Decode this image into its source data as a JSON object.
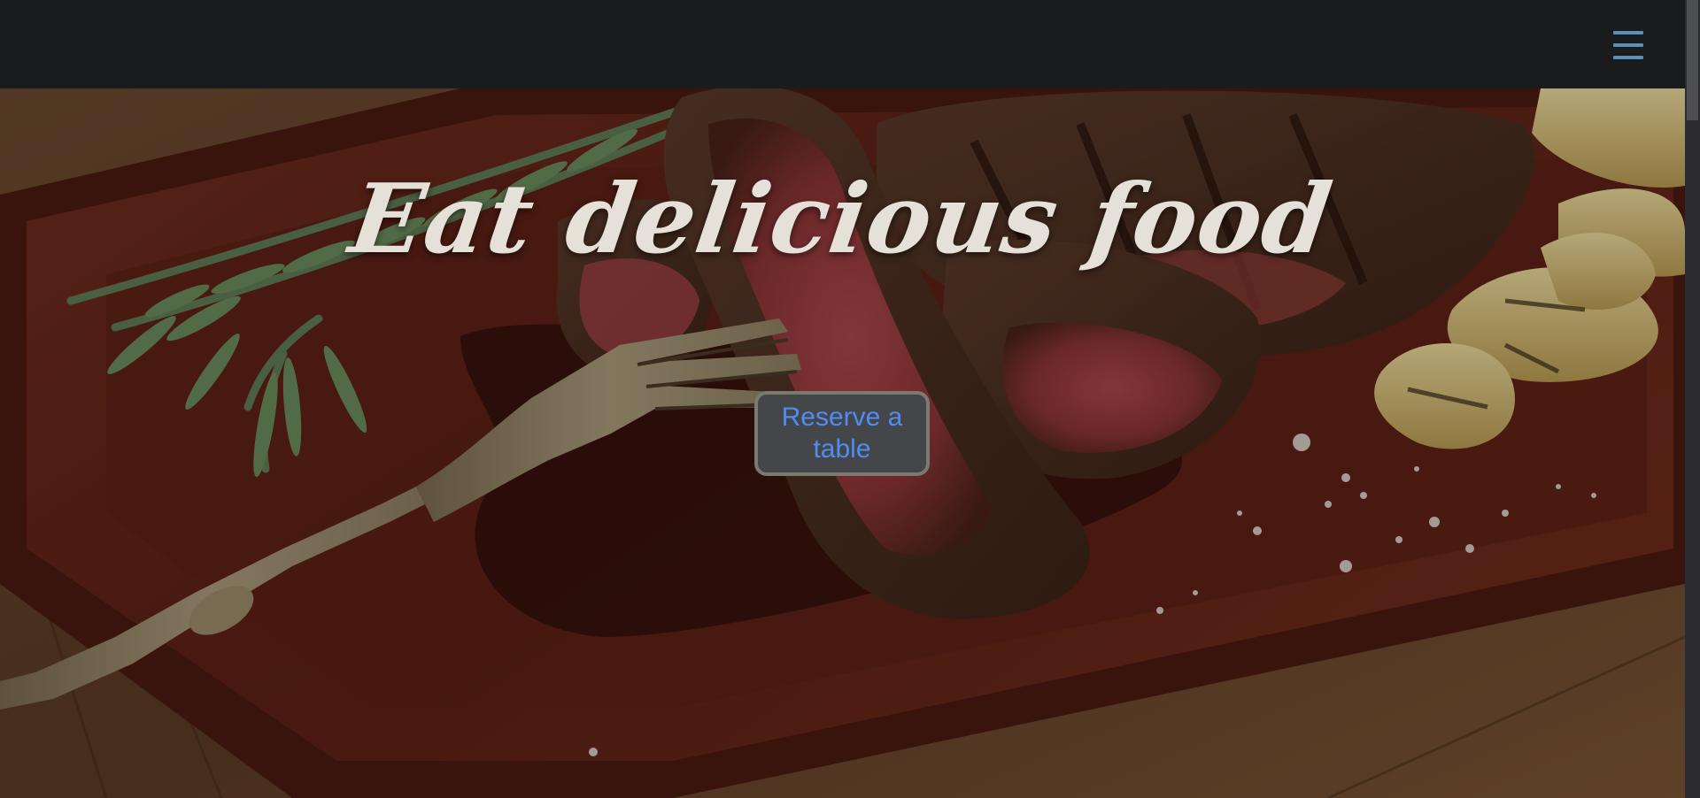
{
  "navbar": {
    "menu_icon": "hamburger-menu-icon",
    "menu_color": "#5c8fb6"
  },
  "hero": {
    "image": "steak-on-cutting-board",
    "title": "Eat delicious food",
    "cta_label": "Reserve a table",
    "cta_text_color": "#4e8ef0"
  },
  "scrollbar": {
    "scroll_fraction": 0.0
  }
}
